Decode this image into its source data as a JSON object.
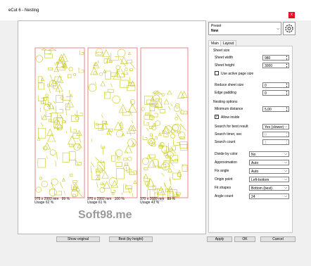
{
  "window": {
    "title": "eCut 6 - Nesting",
    "close_glyph": "x"
  },
  "preset": {
    "label": "Preset",
    "value": "New",
    "dropdown_glyph": "⌵"
  },
  "tabs": [
    {
      "label": "Main"
    },
    {
      "label": "Layout"
    }
  ],
  "sheet_size": {
    "heading": "Sheet size",
    "width_label": "Sheet width",
    "width_value": "980",
    "height_label": "Sheet height",
    "height_value": "3000",
    "use_active_label": "Use active page size"
  },
  "reduce": {
    "reduce_label": "Reduce sheet size",
    "reduce_value": "0",
    "edge_label": "Edge padding",
    "edge_value": "0"
  },
  "nesting": {
    "heading": "Nesting options",
    "min_dist_label": "Minimum distance",
    "min_dist_value": "5,00",
    "allow_inside_label": "Allow inside",
    "search_best_label": "Search for best result",
    "search_best_value": "Yes (slower)",
    "timer_label": "Search timer, sec",
    "timer_value": "0",
    "count_label": "Search count",
    "count_value": "1"
  },
  "options": {
    "divide_label": "Divide by color",
    "divide_value": "No",
    "approx_label": "Approximation",
    "approx_value": "Auto",
    "fixangle_label": "Fix angle",
    "fixangle_value": "Auto",
    "origin_label": "Origin point",
    "origin_value": "Left-bottom",
    "fitshapes_label": "Fit shapes",
    "fitshapes_value": "Bottom (best)",
    "anglecount_label": "Angle count",
    "anglecount_value": "24"
  },
  "sheets": [
    {
      "size": "975 x 2992 mm",
      "percent": "99 %",
      "usage": "Usage 62 %"
    },
    {
      "size": "970 x 2992 mm",
      "percent": "100 %",
      "usage": "Usage 61 %"
    },
    {
      "size": "970 x 2689 mm",
      "percent": "89 %",
      "usage": "Usage 43 %"
    }
  ],
  "watermark": "Soft98.me",
  "buttons": {
    "show_original": "Show original",
    "best": "Best (by height)",
    "apply": "Apply",
    "ok": "OK",
    "cancel": "Cancel"
  },
  "colors": {
    "shape_stroke": "#c8c81e",
    "sheet_border": "#e26a6a",
    "close_red": "#e81123"
  }
}
